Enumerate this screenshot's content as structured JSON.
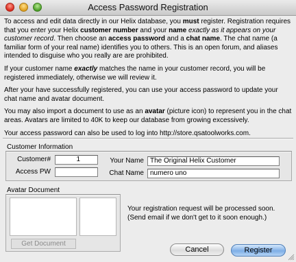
{
  "window": {
    "title": "Access Password Registration"
  },
  "intro": {
    "p1": [
      {
        "t": "To access and edit data directly in our Helix database, you ",
        "s": ""
      },
      {
        "t": "must",
        "s": "b"
      },
      {
        "t": " register. Registration requires that you enter your Helix ",
        "s": ""
      },
      {
        "t": "customer number",
        "s": "b"
      },
      {
        "t": " and your ",
        "s": ""
      },
      {
        "t": "name",
        "s": "b"
      },
      {
        "t": " ",
        "s": ""
      },
      {
        "t": "exactly as it appears on your customer record",
        "s": "i"
      },
      {
        "t": ". Then choose an ",
        "s": ""
      },
      {
        "t": "access password",
        "s": "b"
      },
      {
        "t": " and a ",
        "s": ""
      },
      {
        "t": "chat name",
        "s": "b"
      },
      {
        "t": ". The chat name (a familiar form of your real name) identifies you to others. This is an open forum, and aliases intended to disguise who you really are are prohibited.",
        "s": ""
      }
    ],
    "p2": [
      {
        "t": "If your customer name ",
        "s": ""
      },
      {
        "t": "exactly",
        "s": "bi"
      },
      {
        "t": " matches the name in your customer record, you will be registered immediately, otherwise we will review it.",
        "s": ""
      }
    ],
    "p3": "After your have successfully registered, you can use your access password to update your chat name and avatar document.",
    "p4": [
      {
        "t": "You may also import a document to use as an ",
        "s": ""
      },
      {
        "t": "avatar",
        "s": "b"
      },
      {
        "t": " (picture icon) to represent you in the chat areas. Avatars are limited to 40K to keep our database from growing excessively.",
        "s": ""
      }
    ],
    "p5": "Your access password can also be used to log into http://store.qsatoolworks.com."
  },
  "customer_info": {
    "heading": "Customer Information",
    "customer_label": "Customer#",
    "customer_value": "1",
    "access_pw_label": "Access PW",
    "access_pw_value": "",
    "your_name_label": "Your Name",
    "your_name_value": "The Original Helix Customer",
    "chat_name_label": "Chat Name",
    "chat_name_value": "numero uno"
  },
  "avatar": {
    "heading": "Avatar Document",
    "get_document_label": "Get Document"
  },
  "status": {
    "line1": "Your registration request will be processed soon.",
    "line2": "(Send email if we don't get to it soon enough.)"
  },
  "buttons": {
    "cancel_label": "Cancel",
    "register_label": "Register"
  },
  "colors": {
    "window_bg": "#ececec",
    "default_button": "#7eaee6"
  }
}
